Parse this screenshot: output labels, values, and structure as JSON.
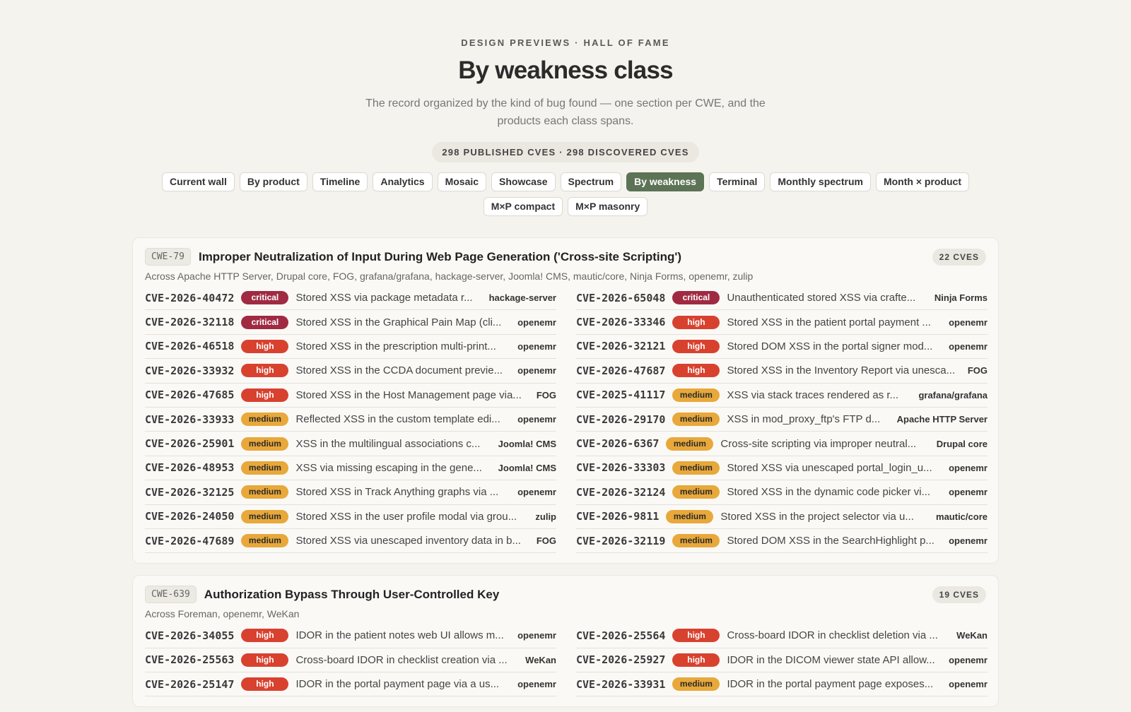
{
  "header": {
    "eyebrow": "DESIGN PREVIEWS · HALL OF FAME",
    "title": "By weakness class",
    "subtitle": "The record organized by the kind of bug found — one section per CWE, and the products each class spans.",
    "counts": "298 PUBLISHED CVES · 298 DISCOVERED CVES"
  },
  "nav": [
    {
      "label": "Current wall"
    },
    {
      "label": "By product"
    },
    {
      "label": "Timeline"
    },
    {
      "label": "Analytics"
    },
    {
      "label": "Mosaic"
    },
    {
      "label": "Showcase"
    },
    {
      "label": "Spectrum"
    },
    {
      "label": "By weakness",
      "active": true
    },
    {
      "label": "Terminal"
    },
    {
      "label": "Monthly spectrum"
    },
    {
      "label": "Month × product"
    },
    {
      "label": "M×P compact"
    },
    {
      "label": "M×P masonry"
    }
  ],
  "colors": {
    "active_nav": "#5c7356",
    "critical": "#a02a42",
    "high": "#d9412f",
    "medium": "#e8a83a"
  },
  "sections": [
    {
      "cwe": "CWE-79",
      "title": "Improper Neutralization of Input During Web Page Generation ('Cross-site Scripting')",
      "count": "22 CVES",
      "across": "Across Apache HTTP Server, Drupal core, FOG, grafana/grafana, hackage-server, Joomla! CMS, mautic/core, Ninja Forms, openemr, zulip",
      "left": [
        {
          "id": "CVE-2026-40472",
          "sev": "critical",
          "desc": "Stored XSS via package metadata r...",
          "product": "hackage-server"
        },
        {
          "id": "CVE-2026-32118",
          "sev": "critical",
          "desc": "Stored XSS in the Graphical Pain Map (cli...",
          "product": "openemr"
        },
        {
          "id": "CVE-2026-46518",
          "sev": "high",
          "desc": "Stored XSS in the prescription multi-print...",
          "product": "openemr"
        },
        {
          "id": "CVE-2026-33932",
          "sev": "high",
          "desc": "Stored XSS in the CCDA document previe...",
          "product": "openemr"
        },
        {
          "id": "CVE-2026-47685",
          "sev": "high",
          "desc": "Stored XSS in the Host Management page via...",
          "product": "FOG"
        },
        {
          "id": "CVE-2026-33933",
          "sev": "medium",
          "desc": "Reflected XSS in the custom template edi...",
          "product": "openemr"
        },
        {
          "id": "CVE-2026-25901",
          "sev": "medium",
          "desc": "XSS in the multilingual associations c...",
          "product": "Joomla! CMS"
        },
        {
          "id": "CVE-2026-48953",
          "sev": "medium",
          "desc": "XSS via missing escaping in the gene...",
          "product": "Joomla! CMS"
        },
        {
          "id": "CVE-2026-32125",
          "sev": "medium",
          "desc": "Stored XSS in Track Anything graphs via ...",
          "product": "openemr"
        },
        {
          "id": "CVE-2026-24050",
          "sev": "medium",
          "desc": "Stored XSS in the user profile modal via grou...",
          "product": "zulip"
        },
        {
          "id": "CVE-2026-47689",
          "sev": "medium",
          "desc": "Stored XSS via unescaped inventory data in b...",
          "product": "FOG"
        }
      ],
      "right": [
        {
          "id": "CVE-2026-65048",
          "sev": "critical",
          "desc": "Unauthenticated stored XSS via crafte...",
          "product": "Ninja Forms"
        },
        {
          "id": "CVE-2026-33346",
          "sev": "high",
          "desc": "Stored XSS in the patient portal payment ...",
          "product": "openemr"
        },
        {
          "id": "CVE-2026-32121",
          "sev": "high",
          "desc": "Stored DOM XSS in the portal signer mod...",
          "product": "openemr"
        },
        {
          "id": "CVE-2026-47687",
          "sev": "high",
          "desc": "Stored XSS in the Inventory Report via unesca...",
          "product": "FOG"
        },
        {
          "id": "CVE-2025-41117",
          "sev": "medium",
          "desc": "XSS via stack traces rendered as r...",
          "product": "grafana/grafana"
        },
        {
          "id": "CVE-2026-29170",
          "sev": "medium",
          "desc": "XSS in mod_proxy_ftp's FTP d...",
          "product": "Apache HTTP Server"
        },
        {
          "id": "CVE-2026-6367",
          "sev": "medium",
          "desc": "Cross-site scripting via improper neutral...",
          "product": "Drupal core"
        },
        {
          "id": "CVE-2026-33303",
          "sev": "medium",
          "desc": "Stored XSS via unescaped portal_login_u...",
          "product": "openemr"
        },
        {
          "id": "CVE-2026-32124",
          "sev": "medium",
          "desc": "Stored XSS in the dynamic code picker vi...",
          "product": "openemr"
        },
        {
          "id": "CVE-2026-9811",
          "sev": "medium",
          "desc": "Stored XSS in the project selector via u...",
          "product": "mautic/core"
        },
        {
          "id": "CVE-2026-32119",
          "sev": "medium",
          "desc": "Stored DOM XSS in the SearchHighlight p...",
          "product": "openemr"
        }
      ]
    },
    {
      "cwe": "CWE-639",
      "title": "Authorization Bypass Through User-Controlled Key",
      "count": "19 CVES",
      "across": "Across Foreman, openemr, WeKan",
      "left": [
        {
          "id": "CVE-2026-34055",
          "sev": "high",
          "desc": "IDOR in the patient notes web UI allows m...",
          "product": "openemr"
        },
        {
          "id": "CVE-2026-25563",
          "sev": "high",
          "desc": "Cross-board IDOR in checklist creation via ...",
          "product": "WeKan"
        },
        {
          "id": "CVE-2026-25147",
          "sev": "high",
          "desc": "IDOR in the portal payment page via a us...",
          "product": "openemr"
        }
      ],
      "right": [
        {
          "id": "CVE-2026-25564",
          "sev": "high",
          "desc": "Cross-board IDOR in checklist deletion via ...",
          "product": "WeKan"
        },
        {
          "id": "CVE-2026-25927",
          "sev": "high",
          "desc": "IDOR in the DICOM viewer state API allow...",
          "product": "openemr"
        },
        {
          "id": "CVE-2026-33931",
          "sev": "medium",
          "desc": "IDOR in the portal payment page exposes...",
          "product": "openemr"
        }
      ]
    }
  ]
}
